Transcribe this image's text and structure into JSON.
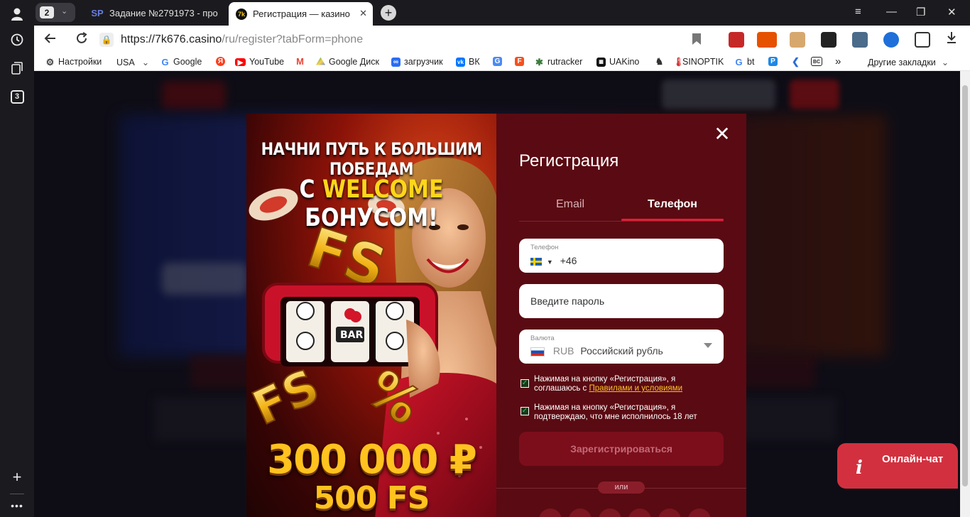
{
  "browser": {
    "tab_count": "2",
    "tabs": [
      {
        "favicon": "SP",
        "title": "Задание №2791973 - про",
        "active": false
      },
      {
        "favicon": "7k",
        "title": "Регистрация — казино",
        "active": true
      }
    ],
    "sidebar_badge": "3",
    "url_host": "https://7k676.casino",
    "url_path": "/ru/register?tabForm=phone",
    "bookmarks": [
      {
        "label": "Настройки",
        "icon": "gear-icon"
      },
      {
        "label": "USA",
        "icon": "chevron-down-icon"
      },
      {
        "label": "Google",
        "icon": "google-icon",
        "color": "#4285f4"
      },
      {
        "label": "",
        "icon": "yandex-icon",
        "color": "#fc3f1d"
      },
      {
        "label": "YouTube",
        "icon": "youtube-icon",
        "color": "#ff0000"
      },
      {
        "label": "",
        "icon": "gmail-icon",
        "color": "#ea4335"
      },
      {
        "label": "Google Диск",
        "icon": "google-drive-icon",
        "color": "#1fa463"
      },
      {
        "label": "загрузчик",
        "icon": "infinity-icon",
        "color": "#2a6df4"
      },
      {
        "label": "ВК",
        "icon": "vk-icon",
        "color": "#0077ff"
      },
      {
        "label": "",
        "icon": "translate-icon",
        "color": "#4a8af4"
      },
      {
        "label": "",
        "icon": "f-icon",
        "color": "#f4511e"
      },
      {
        "label": "rutracker",
        "icon": "rutracker-icon",
        "color": "#3a7a3a"
      },
      {
        "label": "UAKino",
        "icon": "uakino-icon",
        "color": "#111111"
      },
      {
        "label": "",
        "icon": "chess-icon",
        "color": "#333333"
      },
      {
        "label": "SINOPTIK",
        "icon": "thermometer-icon",
        "color": "#d32f2f"
      },
      {
        "label": "bt",
        "icon": "google-icon",
        "color": "#4285f4"
      },
      {
        "label": "",
        "icon": "p-icon",
        "color": "#1e88e5"
      },
      {
        "label": "",
        "icon": "arrow-icon",
        "color": "#2b6cd8"
      },
      {
        "label": "",
        "icon": "bc-icon",
        "color": "#222222"
      }
    ],
    "more_bookmarks": "»",
    "other_bookmarks": "Другие закладки"
  },
  "promo": {
    "headline_line1": "НАЧНИ ПУТЬ К БОЛЬШИМ ПОБЕДАМ",
    "headline_line2_pre": "С ",
    "headline_line2_highlight": "WELCOME",
    "headline_line2_post": " БОНУСОМ!",
    "amount": "300 000 ₽",
    "free_spins": "500 FS"
  },
  "form": {
    "title": "Регистрация",
    "tab_email": "Email",
    "tab_phone": "Телефон",
    "phone_label": "Телефон",
    "phone_value": "+46",
    "password_placeholder": "Введите пароль",
    "currency_label": "Валюта",
    "currency_code": "RUB",
    "currency_name": "Российский рубль",
    "terms_text": "Нажимая на кнопку «Регистрация», я соглашаюсь с ",
    "terms_link": "Правилами и условиями",
    "age_text": "Нажимая на кнопку «Регистрация», я подтверждаю, что мне исполнилось 18 лет",
    "check_mark": "✓",
    "submit_label": "Зарегистрироваться",
    "or_label": "или"
  },
  "chat": {
    "icon": "i",
    "label": "Онлайн-чат"
  },
  "colors": {
    "accent_red": "#e01f35",
    "form_bg": "#5a0a12",
    "link_yellow": "#ffc328"
  }
}
